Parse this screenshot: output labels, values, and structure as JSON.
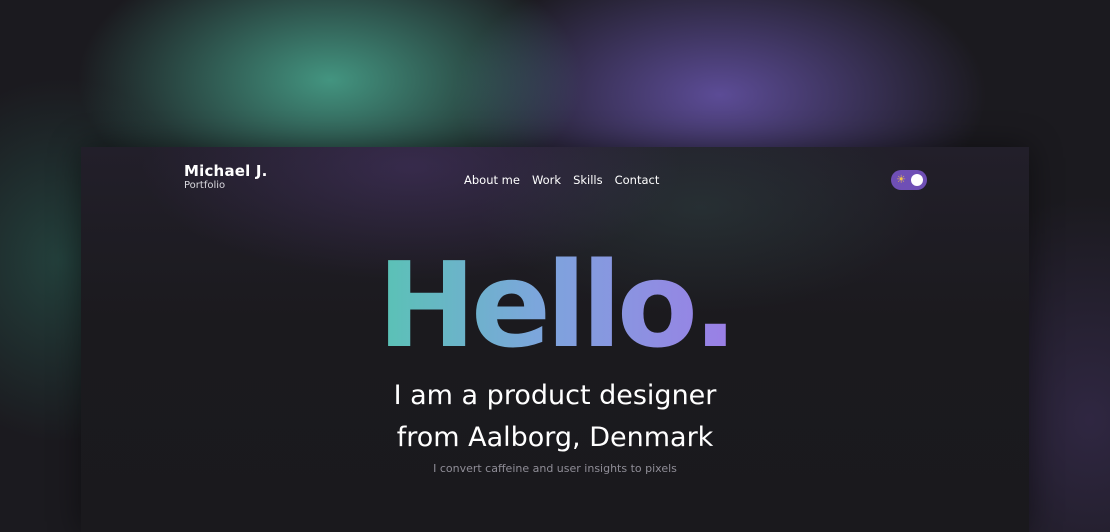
{
  "brand": {
    "name": "Michael J.",
    "subtitle": "Portfolio"
  },
  "nav": {
    "items": [
      {
        "label": "About me"
      },
      {
        "label": "Work"
      },
      {
        "label": "Skills"
      },
      {
        "label": "Contact"
      }
    ]
  },
  "theme_toggle": {
    "icon": "sun-icon",
    "state": "on",
    "track_color": "#6f4fb5",
    "icon_color": "#f3c34a"
  },
  "hero": {
    "title": "Hello.",
    "title_gradient": [
      "#59c3b4",
      "#7ca6dc",
      "#9b7ee6"
    ],
    "subtitle_line1": "I am a product designer",
    "subtitle_line2": "from Aalborg, Denmark",
    "tagline": "I convert caffeine and user insights to pixels"
  },
  "colors": {
    "background": "#1b1a1f",
    "glow_green": "#4aaa91",
    "glow_purple": "#6c58b4",
    "text": "#ffffff",
    "muted_text": "#8f8d97"
  }
}
